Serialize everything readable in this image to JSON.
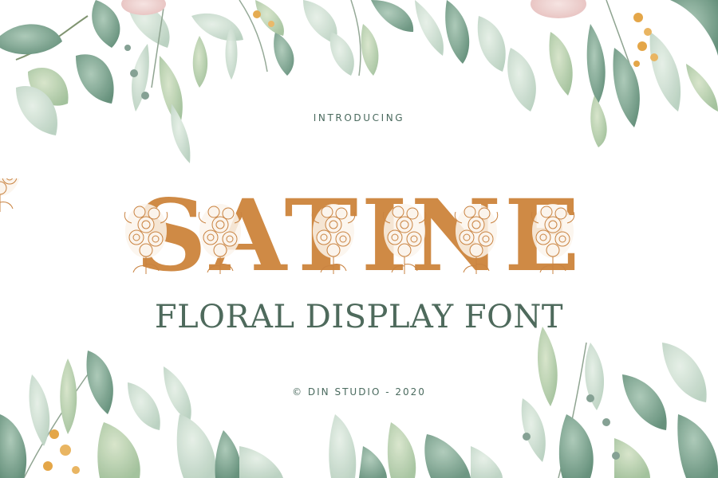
{
  "intro_text": "INTRODUCING",
  "title": "SATINE",
  "subtitle": "FLORAL DISPLAY FONT",
  "credit": "© DIN STUDIO - 2020",
  "colors": {
    "background": "#ffffff",
    "title": "#cf8a45",
    "subtitle": "#4e6a5c",
    "small_text": "#4a6a5e",
    "leaf_dark": "#6f9a84",
    "leaf_light": "#c9dccf",
    "berry": "#e3a23f",
    "rose": "#efcfcf"
  },
  "decorations": [
    "watercolor-leaves",
    "eucalyptus-branch",
    "rose",
    "floral-bouquet-line-art"
  ]
}
